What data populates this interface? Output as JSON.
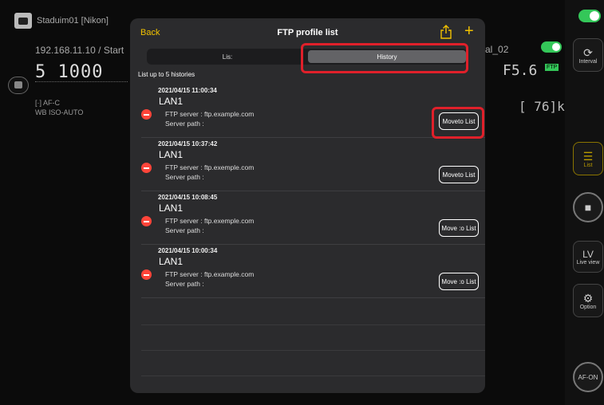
{
  "background": {
    "app_title": "Staduim01 [Nikon]",
    "ip_line": "192.168.11.10 / Start",
    "shutter_display": "5  1000",
    "af_mode": "[·] AF-C",
    "iso_line": "WB  ISO-AUTO",
    "profile_label": "al_02",
    "aperture": "F5.6",
    "ftp_badge": "FTP",
    "remaining": "[ 76]k",
    "rail": {
      "interval_label": "Interval",
      "list_label": "List",
      "lv_label": "LV",
      "liveview_label": "Live view",
      "option_label": "Option",
      "afon_label": "AF-ON"
    }
  },
  "modal": {
    "back_label": "Back",
    "title": "FTP profile list",
    "share_icon": "share-icon",
    "add_icon": "plus-icon",
    "tabs": {
      "list_label": "Lis:",
      "history_label": "History",
      "selected": "History"
    },
    "caption": "List up to 5 histories",
    "histories": [
      {
        "date": "2021/04/15 11:00:34",
        "name": "LAN1",
        "server": "FTP server : ftp.example.com",
        "path": "Server path :",
        "button": "Moveto List"
      },
      {
        "date": "2021/04/15 10:37:42",
        "name": "LAN1",
        "server": "FTP server : ftp.exemple.com",
        "path": "Server path :",
        "button": "Moveto List"
      },
      {
        "date": "2021/04/15 10:08:45",
        "name": "LAN1",
        "server": "FTP server : ftp.exemple.com",
        "path": "Server path :",
        "button": "Move :o List"
      },
      {
        "date": "2021/04/15 10:00:34",
        "name": "LAN1",
        "server": "FTP server : ftp.example.com",
        "path": "Server path :",
        "button": "Move :o List"
      }
    ]
  },
  "colors": {
    "accent": "#f2c200",
    "delete": "#ff453a",
    "highlight": "#e0202a",
    "toggle_on": "#34c759"
  }
}
